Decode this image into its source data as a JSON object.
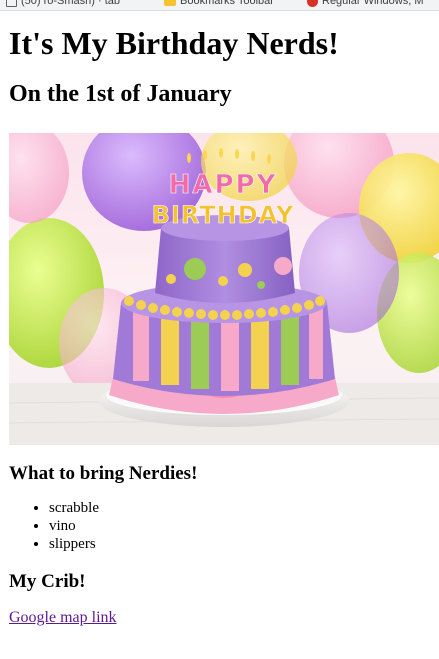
{
  "bookmarks": [
    {
      "label": "(50) ro-Smash) · tab",
      "icon": "page-icon",
      "color": "#5f6368"
    },
    {
      "label": "Bookmarks Toolbar",
      "icon": "folder-icon",
      "color": "#f4c430"
    },
    {
      "label": "Regular Windows, M",
      "icon": "site-icon",
      "color": "#d93025"
    }
  ],
  "page": {
    "title": "It's My Birthday Nerds!",
    "subtitle": "On the 1st of January",
    "cake_text_top": "HAPPY",
    "cake_text_bottom": "BIRTHDAY",
    "bring_heading": "What to bring Nerdies!",
    "bring_items": [
      "scrabble",
      "vino",
      "slippers"
    ],
    "crib_heading": "My Crib!",
    "map_link": "Google map link"
  },
  "colors": {
    "link_visited": "#5b1a8e",
    "cake_purple": "#9b72d0",
    "cake_pink": "#f4a6c9",
    "cake_yellow": "#f2d34f",
    "cake_green": "#8bc34a"
  }
}
